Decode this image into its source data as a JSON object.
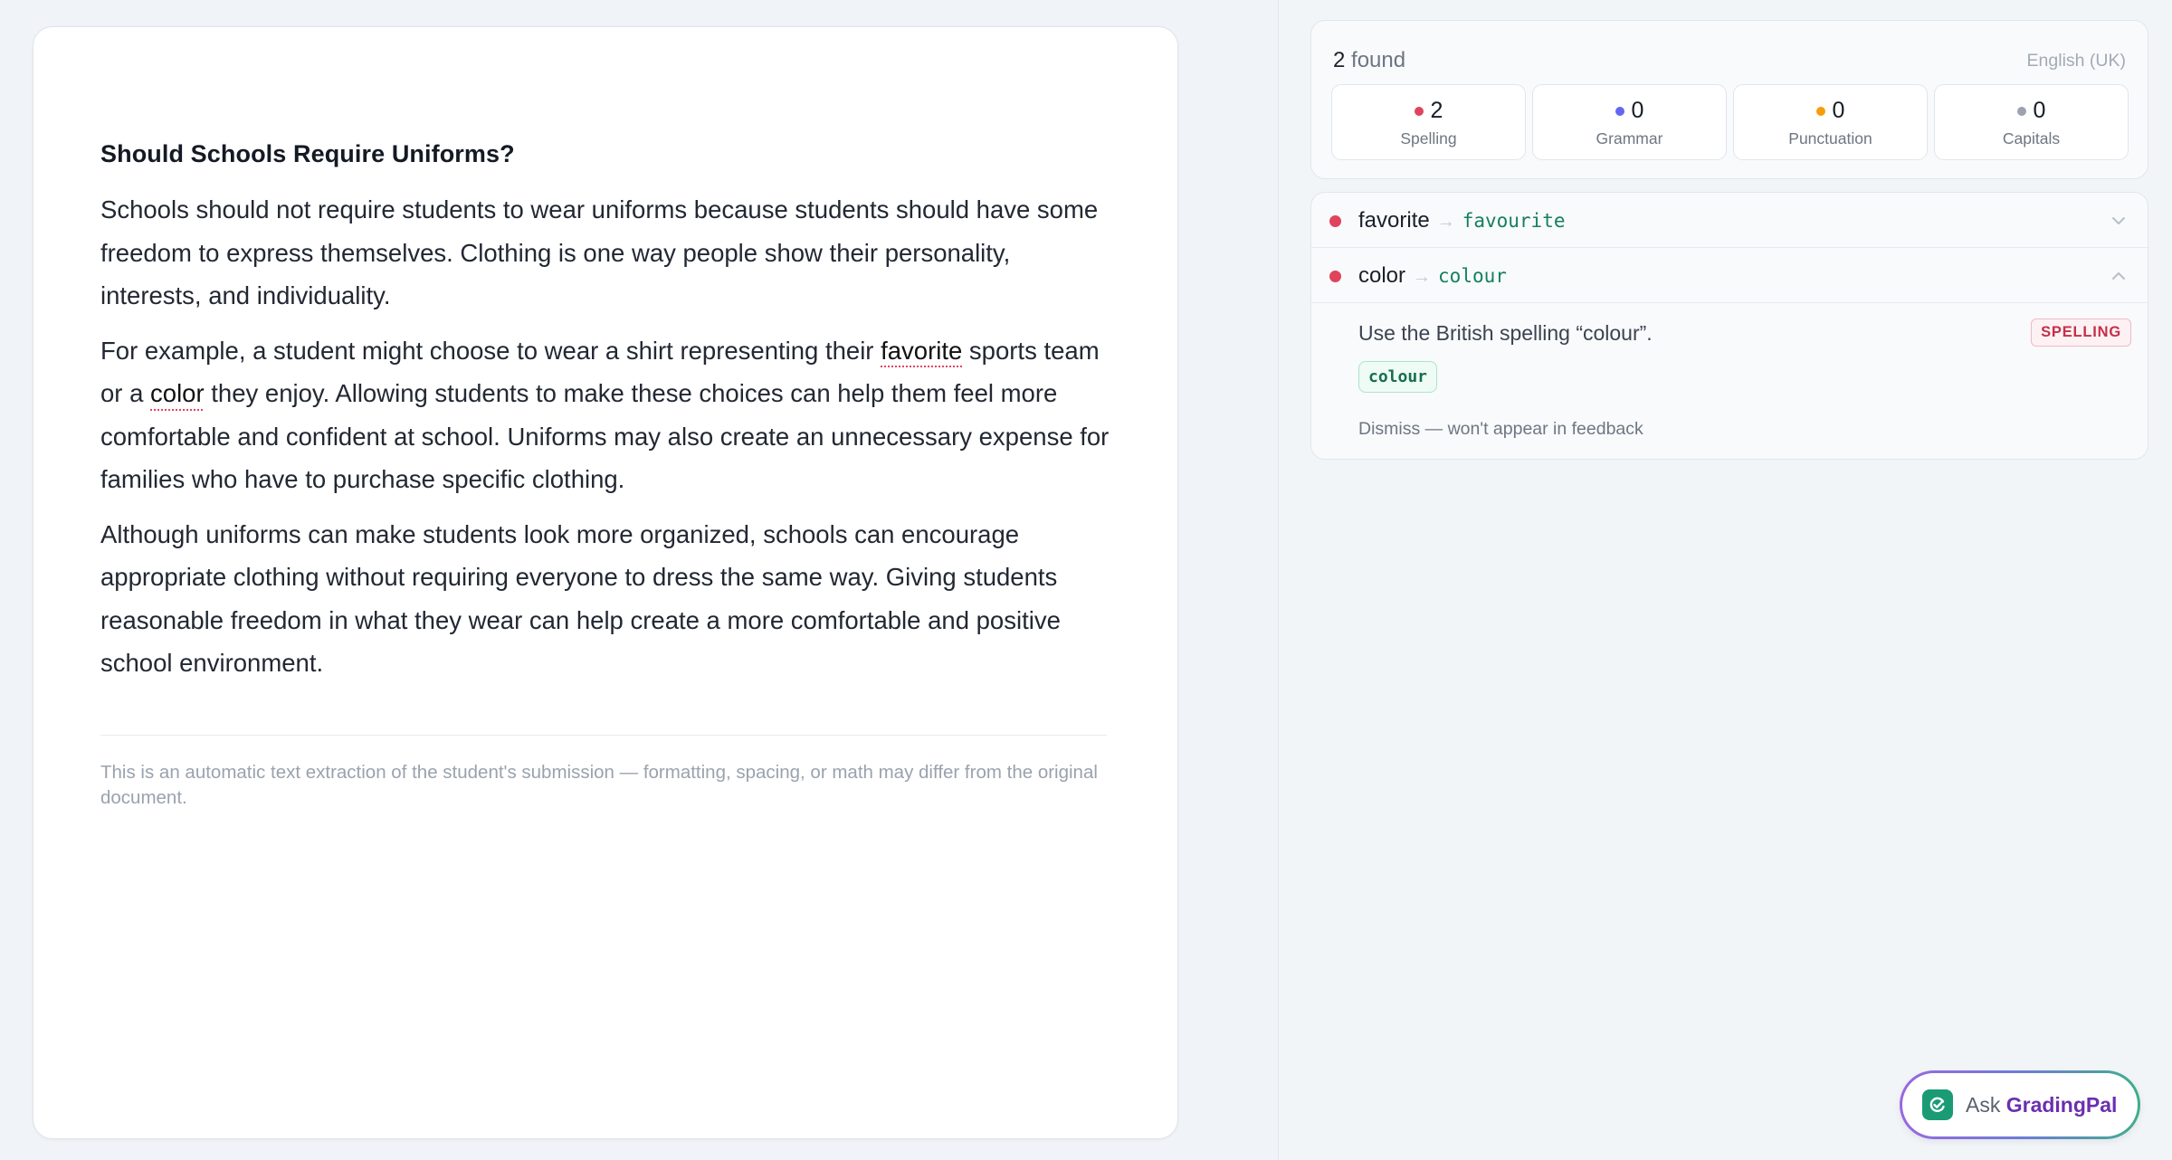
{
  "document": {
    "title": "Should Schools Require Uniforms?",
    "paragraphs": [
      {
        "text": "Schools should not require students to wear uniforms because students should have some freedom to express themselves. Clothing is one way people show their personality, interests, and individuality."
      },
      {
        "part1": "For example, a student might choose to wear a shirt representing their ",
        "flag1": "favorite",
        "part2": " sports team or a ",
        "flag2": "color",
        "part3": " they enjoy. Allowing students to make these choices can help them feel more comfortable and confident at school. Uniforms may also create an unnecessary expense for families who have to purchase specific clothing."
      },
      {
        "text": "Although uniforms can make students look more organized, schools can encourage appropriate clothing without requiring everyone to dress the same way. Giving students reasonable freedom in what they wear can help create a more comfortable and positive school environment."
      }
    ],
    "note": "This is an automatic text extraction of the student's submission — formatting, spacing, or math may differ from the original document."
  },
  "summary": {
    "count": "2",
    "found_label": "found",
    "language": "English (UK)",
    "stats": [
      {
        "value": "2",
        "label": "Spelling",
        "color": "#e0445c"
      },
      {
        "value": "0",
        "label": "Grammar",
        "color": "#6366f1"
      },
      {
        "value": "0",
        "label": "Punctuation",
        "color": "#f59e0b"
      },
      {
        "value": "0",
        "label": "Capitals",
        "color": "#9ca3af"
      }
    ]
  },
  "issues": [
    {
      "word": "favorite",
      "arrow": "→",
      "suggestion": "favourite",
      "expanded": false,
      "icon": "chevron-down-icon"
    },
    {
      "word": "color",
      "arrow": "→",
      "suggestion": "colour",
      "expanded": true,
      "icon": "chevron-up-icon",
      "message": "Use the British spelling “colour”.",
      "badge": "SPELLING",
      "chip": "colour",
      "dismiss": "Dismiss — won't appear in feedback"
    }
  ],
  "ask": {
    "prefix": "Ask",
    "brand": "GradingPal",
    "icon": "gradingpal-logo-icon"
  },
  "colors": {
    "error": "#e0445c",
    "suggestion": "#15805a",
    "brand": "#6a2fb0"
  }
}
